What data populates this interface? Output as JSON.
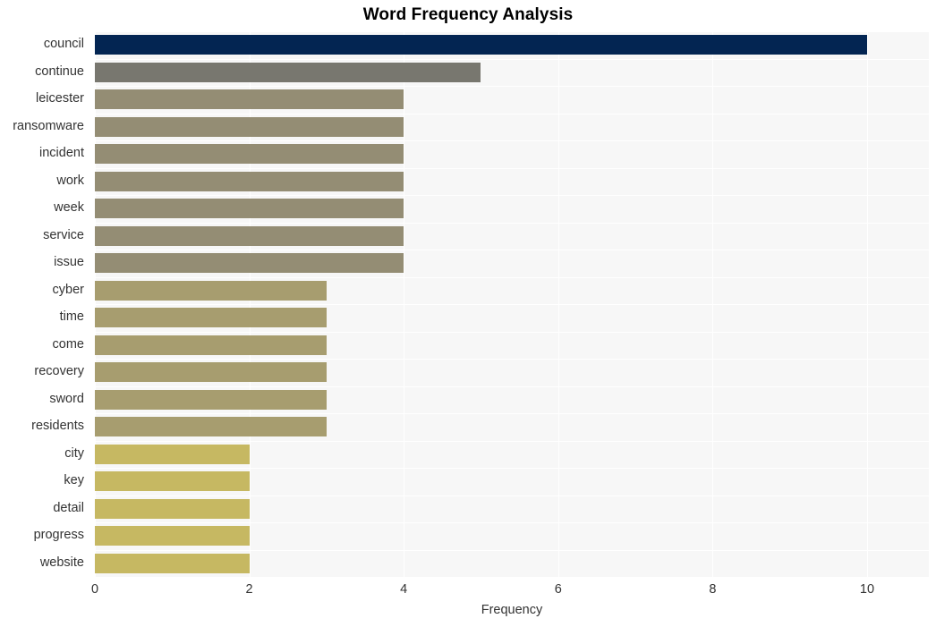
{
  "chart_data": {
    "type": "bar",
    "orientation": "horizontal",
    "title": "Word Frequency Analysis",
    "xlabel": "Frequency",
    "ylabel": "",
    "categories": [
      "council",
      "continue",
      "leicester",
      "ransomware",
      "incident",
      "work",
      "week",
      "service",
      "issue",
      "cyber",
      "time",
      "come",
      "recovery",
      "sword",
      "residents",
      "city",
      "key",
      "detail",
      "progress",
      "website"
    ],
    "values": [
      10,
      5,
      4,
      4,
      4,
      4,
      4,
      4,
      4,
      3,
      3,
      3,
      3,
      3,
      3,
      2,
      2,
      2,
      2,
      2
    ],
    "bar_colors": [
      "#032552",
      "#78776f",
      "#948d74",
      "#948d74",
      "#948d74",
      "#948d74",
      "#948d74",
      "#948d74",
      "#948d74",
      "#a79d6f",
      "#a79d6f",
      "#a79d6f",
      "#a79d6f",
      "#a79d6f",
      "#a79d6f",
      "#c6b862",
      "#c6b862",
      "#c6b862",
      "#c6b862",
      "#c6b862"
    ],
    "xlim": [
      0,
      10.8
    ],
    "xticks": [
      0,
      2,
      4,
      6,
      8,
      10
    ],
    "xtick_labels": [
      "0",
      "2",
      "4",
      "6",
      "8",
      "10"
    ],
    "grid": true,
    "grid_color": "#ffffff",
    "plot_background": "#f7f7f7",
    "legend": null
  }
}
